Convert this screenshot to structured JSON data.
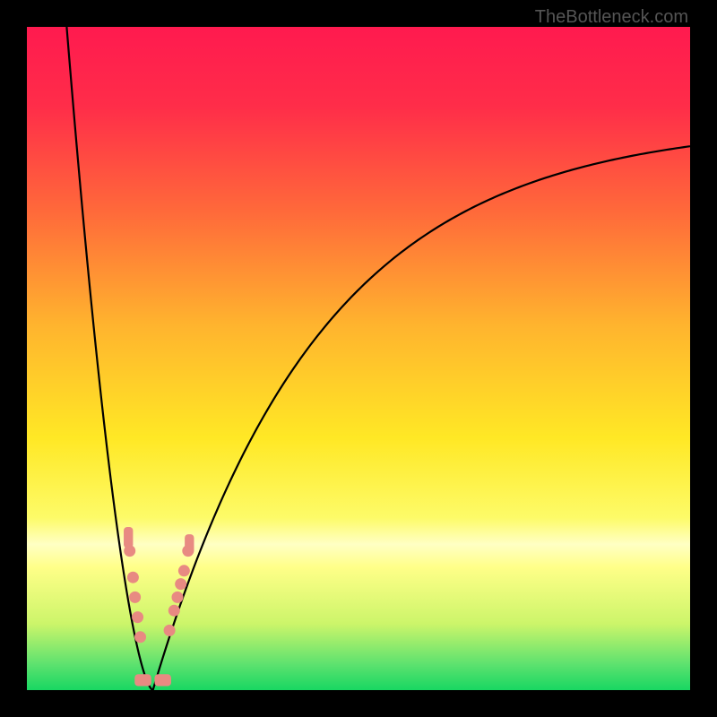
{
  "watermark": "TheBottleneck.com",
  "chart_data": {
    "type": "line",
    "title": "",
    "xlabel": "",
    "ylabel": "",
    "xlim": [
      0,
      100
    ],
    "ylim": [
      0,
      100
    ],
    "curves": [
      {
        "name": "left-branch",
        "description": "steep descending curve from top-left corner to minimum",
        "start": {
          "x": 6,
          "y": 100
        },
        "end": {
          "x": 19,
          "y": 0
        }
      },
      {
        "name": "right-branch",
        "description": "rising curve from minimum to upper-right with decreasing slope",
        "start": {
          "x": 19,
          "y": 0
        },
        "end": {
          "x": 100,
          "y": 82
        }
      }
    ],
    "minimum_x": 19,
    "markers": {
      "left_cluster": [
        {
          "x": 15.5,
          "y": 21
        },
        {
          "x": 16.0,
          "y": 17
        },
        {
          "x": 16.3,
          "y": 14
        },
        {
          "x": 16.7,
          "y": 11
        },
        {
          "x": 17.1,
          "y": 8
        }
      ],
      "right_cluster": [
        {
          "x": 21.5,
          "y": 9
        },
        {
          "x": 22.2,
          "y": 12
        },
        {
          "x": 22.7,
          "y": 14
        },
        {
          "x": 23.2,
          "y": 16
        },
        {
          "x": 23.7,
          "y": 18
        },
        {
          "x": 24.3,
          "y": 21
        }
      ],
      "bottom_pills": [
        {
          "x": 17.5,
          "y": 1.5,
          "w": 2.5
        },
        {
          "x": 20.5,
          "y": 1.5,
          "w": 2.5
        }
      ],
      "top_left_pill": {
        "x": 15.3,
        "y": 23,
        "w": 1.4,
        "h": 3.2
      },
      "top_right_pill": {
        "x": 24.5,
        "y": 22,
        "w": 1.4,
        "h": 3.0
      }
    },
    "gradient_stops": [
      {
        "offset": 0.0,
        "color": "#ff1a4f"
      },
      {
        "offset": 0.12,
        "color": "#ff2d49"
      },
      {
        "offset": 0.28,
        "color": "#ff6a3a"
      },
      {
        "offset": 0.45,
        "color": "#ffb42e"
      },
      {
        "offset": 0.62,
        "color": "#ffe825"
      },
      {
        "offset": 0.74,
        "color": "#fdfb68"
      },
      {
        "offset": 0.78,
        "color": "#ffffc4"
      },
      {
        "offset": 0.815,
        "color": "#ffff88"
      },
      {
        "offset": 0.9,
        "color": "#ccf56a"
      },
      {
        "offset": 0.96,
        "color": "#5fe26f"
      },
      {
        "offset": 1.0,
        "color": "#18d762"
      }
    ]
  }
}
